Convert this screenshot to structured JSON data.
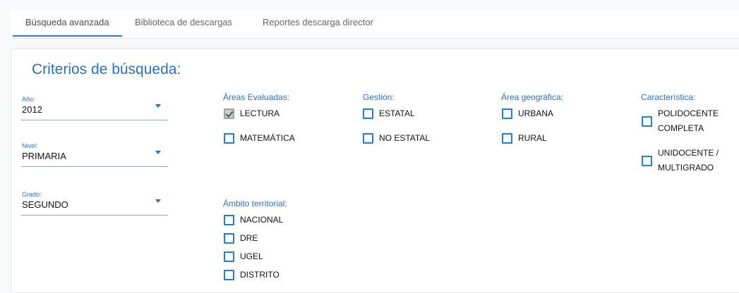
{
  "tabs": [
    {
      "label": "Búsqueda avanzada",
      "active": true
    },
    {
      "label": "Biblioteca de descargas",
      "active": false
    },
    {
      "label": "Reportes descarga director",
      "active": false
    }
  ],
  "criteria": {
    "title": "Criterios de búsqueda:",
    "year": {
      "label": "Año:",
      "value": "2012"
    },
    "level": {
      "label": "Nivel:",
      "value": "PRIMARIA"
    },
    "grade": {
      "label": "Grado:",
      "value": "SEGUNDO"
    }
  },
  "areas": {
    "label": "Áreas Evaluadas:",
    "options": [
      {
        "label": "LECTURA",
        "checked": true
      },
      {
        "label": "MATEMÁTICA",
        "checked": false
      }
    ]
  },
  "gestion": {
    "label": "Gestión:",
    "options": [
      {
        "label": "ESTATAL",
        "checked": false
      },
      {
        "label": "NO ESTATAL",
        "checked": false
      }
    ]
  },
  "area_geo": {
    "label": "Área geográfica:",
    "options": [
      {
        "label": "URBANA",
        "checked": false
      },
      {
        "label": "RURAL",
        "checked": false
      }
    ]
  },
  "caracteristica": {
    "label": "Característica:",
    "options": [
      {
        "label": "POLIDOCENTE COMPLETA",
        "checked": false
      },
      {
        "label": "UNIDOCENTE / MULTIGRADO",
        "checked": false
      }
    ]
  },
  "ambito": {
    "label": "Ámbito territorial:",
    "options": [
      {
        "label": "NACIONAL",
        "checked": false
      },
      {
        "label": "DRE",
        "checked": false
      },
      {
        "label": "UGEL",
        "checked": false
      },
      {
        "label": "DISTRITO",
        "checked": false
      }
    ]
  },
  "colors": {
    "accent": "#2b6fc2",
    "checkbox_border": "#1f7fd6",
    "tab_underline": "#2a7be0"
  }
}
